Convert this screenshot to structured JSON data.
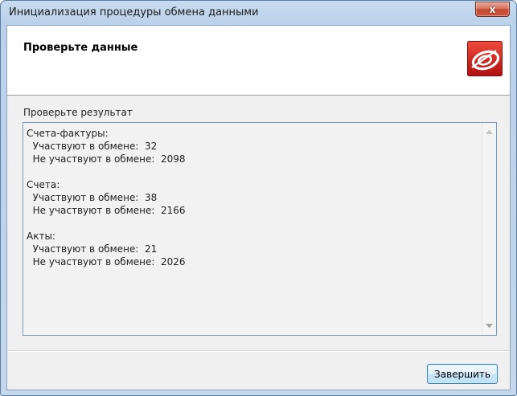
{
  "window": {
    "title": "Инициализация процедуры обмена данными",
    "close_label": "x"
  },
  "header": {
    "title": "Проверьте данные",
    "logo_icon": "red-eye-logo-icon"
  },
  "main": {
    "prompt_label": "Проверьте результат",
    "result_text": "Счета-фактуры:\n  Участвуют в обмене:  32\n  Не участвуют в обмене:  2098\n\nСчета:\n  Участвуют в обмене:  38\n  Не участвуют в обмене:  2166\n\nАкты:\n  Участвуют в обмене:  21\n  Не участвуют в обмене:  2026"
  },
  "footer": {
    "finish_label": "Завершить"
  },
  "colors": {
    "accent": "#3c7fb1",
    "logo_red": "#d42020",
    "close_red": "#c44a34"
  }
}
